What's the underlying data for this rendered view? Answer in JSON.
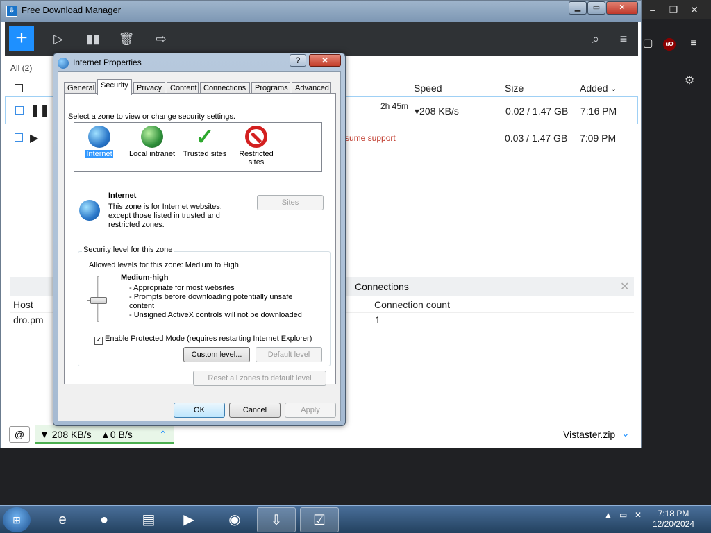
{
  "fdm": {
    "title": "Free Download Manager",
    "filter_all": "All (2)",
    "columns": {
      "speed": "Speed",
      "size": "Size",
      "added": "Added"
    },
    "rows": [
      {
        "time_left": "2h 45m",
        "speed": "208 KB/s",
        "size": "0.02 / 1.47 GB",
        "added": "7:16 PM"
      },
      {
        "status": "sume support",
        "size": "0.03 / 1.47 GB",
        "added": "7:09 PM"
      }
    ],
    "lower_tab": "Connections",
    "lower_columns": {
      "host": "Host",
      "count": "Connection count"
    },
    "lower_row": {
      "host": "dro.pm",
      "count": "1"
    },
    "status": {
      "down": "208 KB/s",
      "up": "0 B/s",
      "file": "Vistaster.zip"
    }
  },
  "dialog": {
    "title": "Internet Properties",
    "tabs": [
      "General",
      "Security",
      "Privacy",
      "Content",
      "Connections",
      "Programs",
      "Advanced"
    ],
    "zone_prompt": "Select a zone to view or change security settings.",
    "zones": [
      "Internet",
      "Local intranet",
      "Trusted sites",
      "Restricted sites"
    ],
    "zone_title": "Internet",
    "zone_desc": "This zone is for Internet websites, except those listed in trusted and restricted zones.",
    "sites_button": "Sites",
    "group_title": "Security level for this zone",
    "allowed": "Allowed levels for this zone: Medium to High",
    "level_title": "Medium-high",
    "level_items": [
      "- Appropriate for most websites",
      "- Prompts before downloading potentially unsafe content",
      "- Unsigned ActiveX controls will not be downloaded"
    ],
    "protected_mode": "Enable Protected Mode (requires restarting Internet Explorer)",
    "custom_level": "Custom level...",
    "default_level": "Default level",
    "reset_all": "Reset all zones to default level",
    "ok": "OK",
    "cancel": "Cancel",
    "apply": "Apply"
  },
  "taskbar": {
    "time": "7:18 PM",
    "date": "12/20/2024"
  }
}
